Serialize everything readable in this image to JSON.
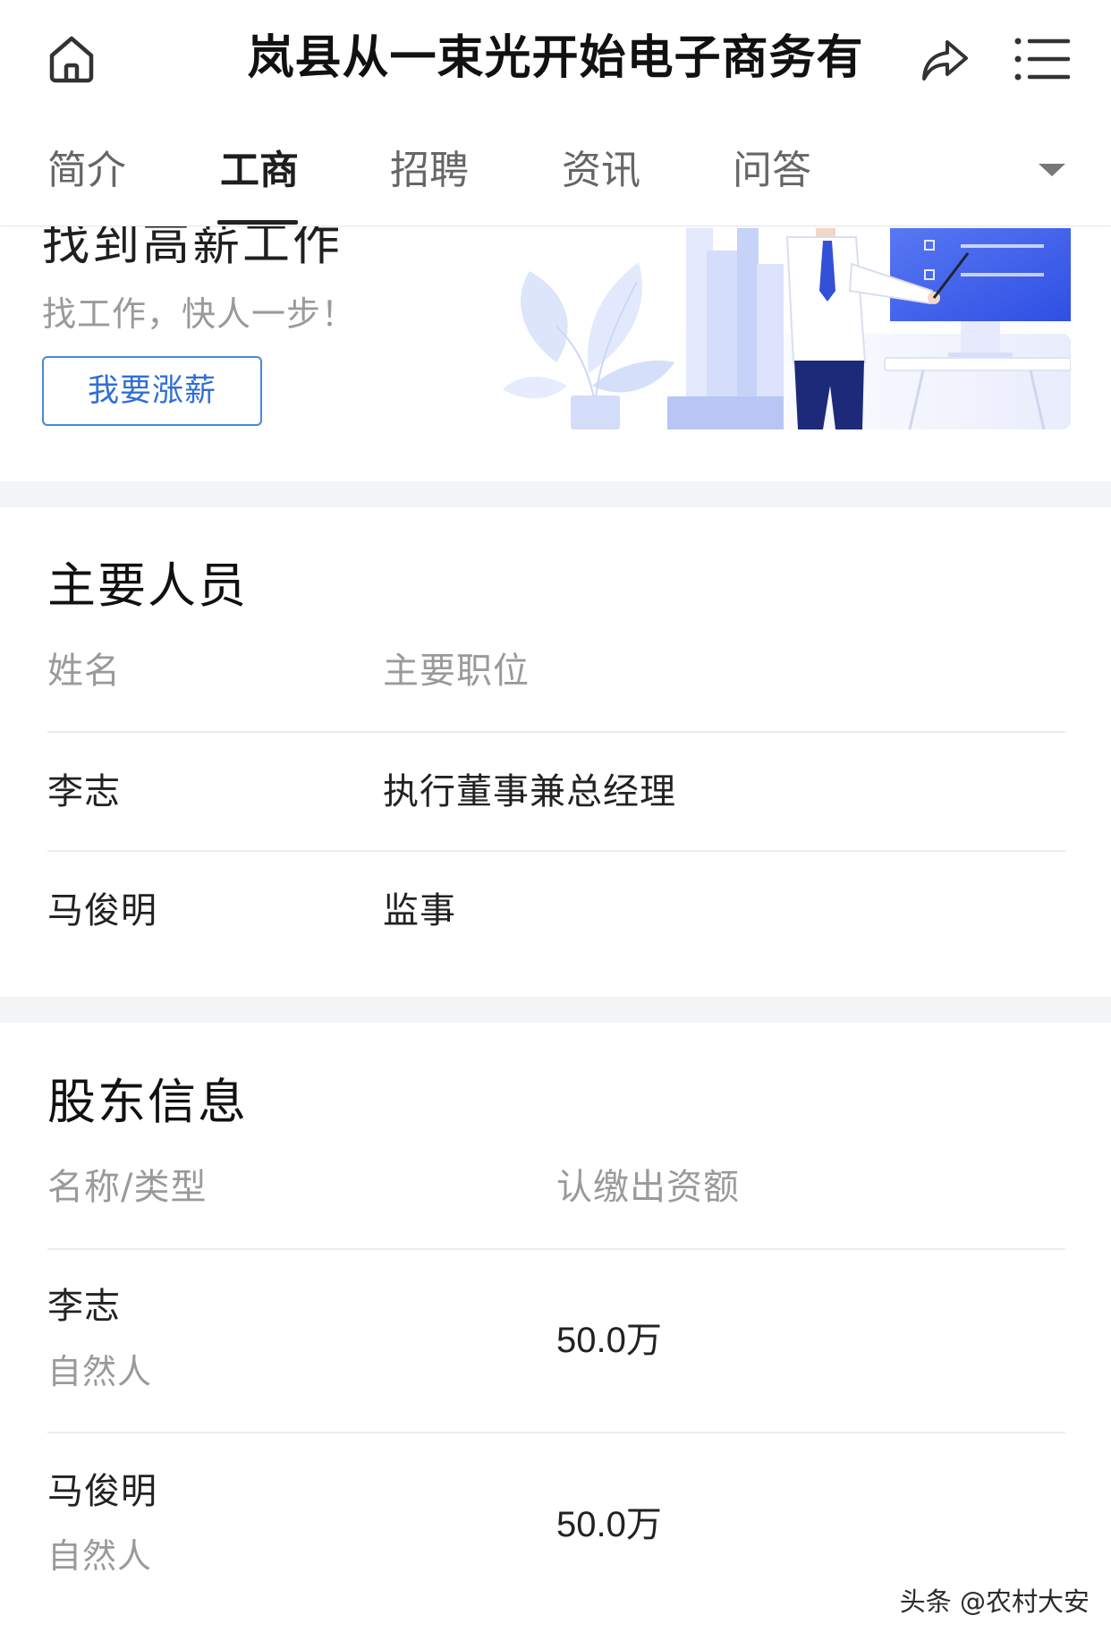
{
  "header": {
    "title": "岚县从一束光开始电子商务有",
    "home_icon": "home-icon",
    "share_icon": "share-icon",
    "menu_icon": "menu-icon"
  },
  "tabs": [
    {
      "label": "简介",
      "active": false
    },
    {
      "label": "工商",
      "active": true
    },
    {
      "label": "招聘",
      "active": false
    },
    {
      "label": "资讯",
      "active": false
    },
    {
      "label": "问答",
      "active": false
    }
  ],
  "tabs_more_icon": "chevron-down-icon",
  "banner": {
    "headline": "找到高薪工作",
    "subtitle": "找工作，快人一步！",
    "button_label": "我要涨薪",
    "illustration": "presenter-illustration"
  },
  "key_personnel": {
    "title": "主要人员",
    "columns": [
      "姓名",
      "主要职位"
    ],
    "rows": [
      {
        "name": "李志",
        "position": "执行董事兼总经理"
      },
      {
        "name": "马俊明",
        "position": "监事"
      }
    ]
  },
  "shareholders": {
    "title": "股东信息",
    "columns": [
      "名称/类型",
      "认缴出资额"
    ],
    "rows": [
      {
        "name": "李志",
        "type": "自然人",
        "amount": "50.0万"
      },
      {
        "name": "马俊明",
        "type": "自然人",
        "amount": "50.0万"
      }
    ]
  },
  "watermark": "头条 @农村大安",
  "colors": {
    "accent": "#2f6fd6",
    "accent_border": "#4a86e0",
    "text_primary": "#222222",
    "text_secondary": "#9a9a9a",
    "divider": "#ececec",
    "section_gap": "#f3f4f6"
  }
}
